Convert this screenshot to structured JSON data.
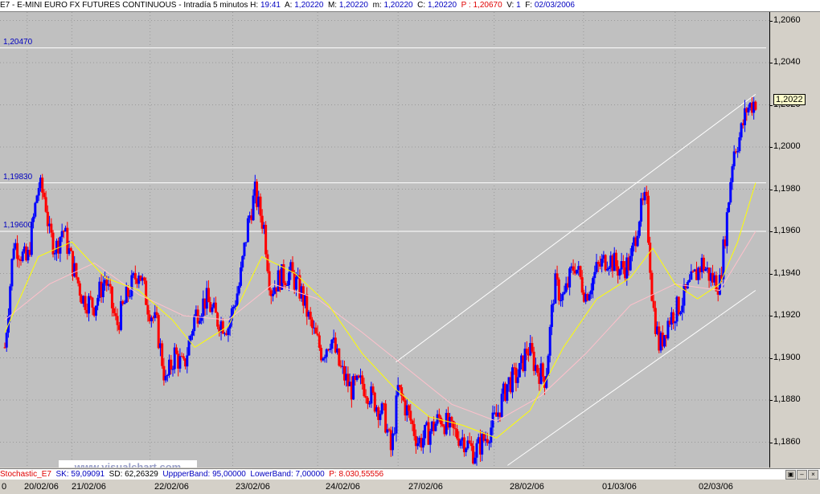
{
  "header": {
    "symbol": "E7",
    "name": "- E-MINI EURO FX FUTURES CONTINUOUS - Intradía 5 minutos",
    "hour_label": "H:",
    "hour_value": "19:41",
    "a_label": "A:",
    "a_value": "1,20220",
    "m_label": "M:",
    "m_value": "1,20220",
    "lo_label": "m:",
    "lo_value": "1,20220",
    "c_label": "C:",
    "c_value": "1,20220",
    "p_label": "P :",
    "p_value": "1,20670",
    "v_label": "V:",
    "v_value": "1",
    "f_label": "F:",
    "f_value": "02/03/2006"
  },
  "window_buttons": [
    "minimize-icon",
    "maximize-icon",
    "close-icon"
  ],
  "levels": [
    {
      "label": "1,20470",
      "value": 1.2047
    },
    {
      "label": "1,19830",
      "value": 1.1983
    },
    {
      "label": "1,19600",
      "value": 1.196
    }
  ],
  "current_price": "1,2022",
  "watermark": "www.visualchart.com",
  "stochastic": {
    "name": "Stochastic_E7",
    "sk": "SK: 59,09091",
    "sd": "SD: 62,26329",
    "upper": "UppperBand: 95,00000",
    "lower": "LowerBand: 7,00000",
    "p": "P: 8.030,55556"
  },
  "xaxis_start": "0",
  "colors": {
    "up_candle": "#0000ff",
    "down_candle": "#ff0000",
    "fast_ma": "#ffff00",
    "slow_ma": "#ffc0cb",
    "level_line": "#ffffff",
    "background": "#c0c0c0"
  },
  "chart_data": {
    "type": "candlestick",
    "title": "E7 - E-MINI EURO FX FUTURES CONTINUOUS - Intradía 5 minutos",
    "ylim": [
      1.1848,
      1.2064
    ],
    "yticks": [
      "1,2060",
      "1,2040",
      "1,2020",
      "1,2000",
      "1,1980",
      "1,1960",
      "1,1940",
      "1,1920",
      "1,1900",
      "1,1880",
      "1,1860"
    ],
    "ytick_values": [
      1.206,
      1.204,
      1.202,
      1.2,
      1.198,
      1.196,
      1.194,
      1.192,
      1.19,
      1.188,
      1.186
    ],
    "x_categories": [
      "20/02/06",
      "21/02/06",
      "22/02/06",
      "23/02/06",
      "24/02/06",
      "27/02/06",
      "28/02/06",
      "01/03/06",
      "02/03/06"
    ],
    "grid": true,
    "price_path": [
      [
        0,
        1.1905
      ],
      [
        0.4,
        1.1955
      ],
      [
        1.0,
        1.1945
      ],
      [
        1.5,
        1.1982
      ],
      [
        1.8,
        1.1976
      ],
      [
        2.0,
        1.1958
      ],
      [
        2.3,
        1.1952
      ],
      [
        2.6,
        1.1962
      ],
      [
        3.0,
        1.1945
      ],
      [
        3.5,
        1.1928
      ],
      [
        4.0,
        1.1925
      ],
      [
        4.5,
        1.1938
      ],
      [
        5.0,
        1.1915
      ],
      [
        5.5,
        1.193
      ],
      [
        6.0,
        1.1942
      ],
      [
        6.4,
        1.1925
      ],
      [
        6.8,
        1.1915
      ],
      [
        7.2,
        1.1888
      ],
      [
        7.6,
        1.1902
      ],
      [
        8.0,
        1.1895
      ],
      [
        8.5,
        1.192
      ],
      [
        9.0,
        1.1928
      ],
      [
        9.5,
        1.1918
      ],
      [
        10.0,
        1.1915
      ],
      [
        10.5,
        1.1935
      ],
      [
        10.9,
        1.1965
      ],
      [
        11.2,
        1.1978
      ],
      [
        11.6,
        1.1962
      ],
      [
        11.9,
        1.1932
      ],
      [
        12.3,
        1.1938
      ],
      [
        12.8,
        1.194
      ],
      [
        13.3,
        1.193
      ],
      [
        13.7,
        1.1915
      ],
      [
        14.2,
        1.1902
      ],
      [
        14.6,
        1.191
      ],
      [
        15.0,
        1.1895
      ],
      [
        15.5,
        1.1885
      ],
      [
        16.0,
        1.1888
      ],
      [
        16.5,
        1.188
      ],
      [
        17.0,
        1.1872
      ],
      [
        17.3,
        1.1855
      ],
      [
        17.6,
        1.1885
      ],
      [
        18.0,
        1.1875
      ],
      [
        18.5,
        1.186
      ],
      [
        19.0,
        1.1865
      ],
      [
        19.5,
        1.1872
      ],
      [
        20.0,
        1.1865
      ],
      [
        20.5,
        1.1862
      ],
      [
        21.0,
        1.1855
      ],
      [
        21.5,
        1.1862
      ],
      [
        22.0,
        1.1872
      ],
      [
        22.5,
        1.1888
      ],
      [
        23.0,
        1.1892
      ],
      [
        23.4,
        1.1905
      ],
      [
        23.8,
        1.1895
      ],
      [
        24.2,
        1.189
      ],
      [
        24.6,
        1.1935
      ],
      [
        25.0,
        1.1928
      ],
      [
        25.5,
        1.1945
      ],
      [
        26.0,
        1.193
      ],
      [
        26.5,
        1.1942
      ],
      [
        27.0,
        1.1948
      ],
      [
        27.5,
        1.1942
      ],
      [
        28.0,
        1.1945
      ],
      [
        28.4,
        1.1968
      ],
      [
        28.7,
        1.1975
      ],
      [
        29.0,
        1.1925
      ],
      [
        29.3,
        1.1905
      ],
      [
        29.7,
        1.1918
      ],
      [
        30.2,
        1.1925
      ],
      [
        30.7,
        1.1935
      ],
      [
        31.2,
        1.1945
      ],
      [
        31.6,
        1.1938
      ],
      [
        32.0,
        1.1935
      ],
      [
        32.3,
        1.1965
      ],
      [
        32.6,
        1.1998
      ],
      [
        32.9,
        1.2005
      ],
      [
        33.2,
        1.2018
      ],
      [
        33.6,
        1.2022
      ]
    ],
    "fast_ma": [
      [
        0,
        1.1912
      ],
      [
        1.5,
        1.1948
      ],
      [
        3.0,
        1.1955
      ],
      [
        4.5,
        1.1938
      ],
      [
        6.0,
        1.1932
      ],
      [
        7.5,
        1.1918
      ],
      [
        8.5,
        1.1905
      ],
      [
        10.0,
        1.1915
      ],
      [
        11.5,
        1.1948
      ],
      [
        13.0,
        1.194
      ],
      [
        14.5,
        1.1925
      ],
      [
        16.0,
        1.1902
      ],
      [
        17.5,
        1.1885
      ],
      [
        19.0,
        1.1872
      ],
      [
        20.5,
        1.1868
      ],
      [
        22.0,
        1.1862
      ],
      [
        23.5,
        1.1875
      ],
      [
        25.0,
        1.1905
      ],
      [
        26.5,
        1.1928
      ],
      [
        28.0,
        1.1938
      ],
      [
        29.0,
        1.1952
      ],
      [
        30.0,
        1.1935
      ],
      [
        31.0,
        1.1928
      ],
      [
        32.0,
        1.1935
      ],
      [
        32.8,
        1.1955
      ],
      [
        33.6,
        1.1983
      ]
    ],
    "slow_ma": [
      [
        0,
        1.1918
      ],
      [
        2.0,
        1.1935
      ],
      [
        4.0,
        1.1945
      ],
      [
        6.0,
        1.193
      ],
      [
        8.0,
        1.192
      ],
      [
        10.0,
        1.1918
      ],
      [
        12.0,
        1.1935
      ],
      [
        14.0,
        1.1928
      ],
      [
        16.0,
        1.1912
      ],
      [
        18.0,
        1.1895
      ],
      [
        20.0,
        1.1878
      ],
      [
        22.0,
        1.187
      ],
      [
        24.0,
        1.1882
      ],
      [
        26.0,
        1.1902
      ],
      [
        28.0,
        1.1925
      ],
      [
        30.0,
        1.1935
      ],
      [
        32.0,
        1.1932
      ],
      [
        33.6,
        1.196
      ]
    ],
    "channel_upper": [
      [
        17.5,
        1.1898
      ],
      [
        33.6,
        1.2025
      ]
    ],
    "channel_lower": [
      [
        22.5,
        1.1849
      ],
      [
        33.6,
        1.1932
      ]
    ]
  }
}
